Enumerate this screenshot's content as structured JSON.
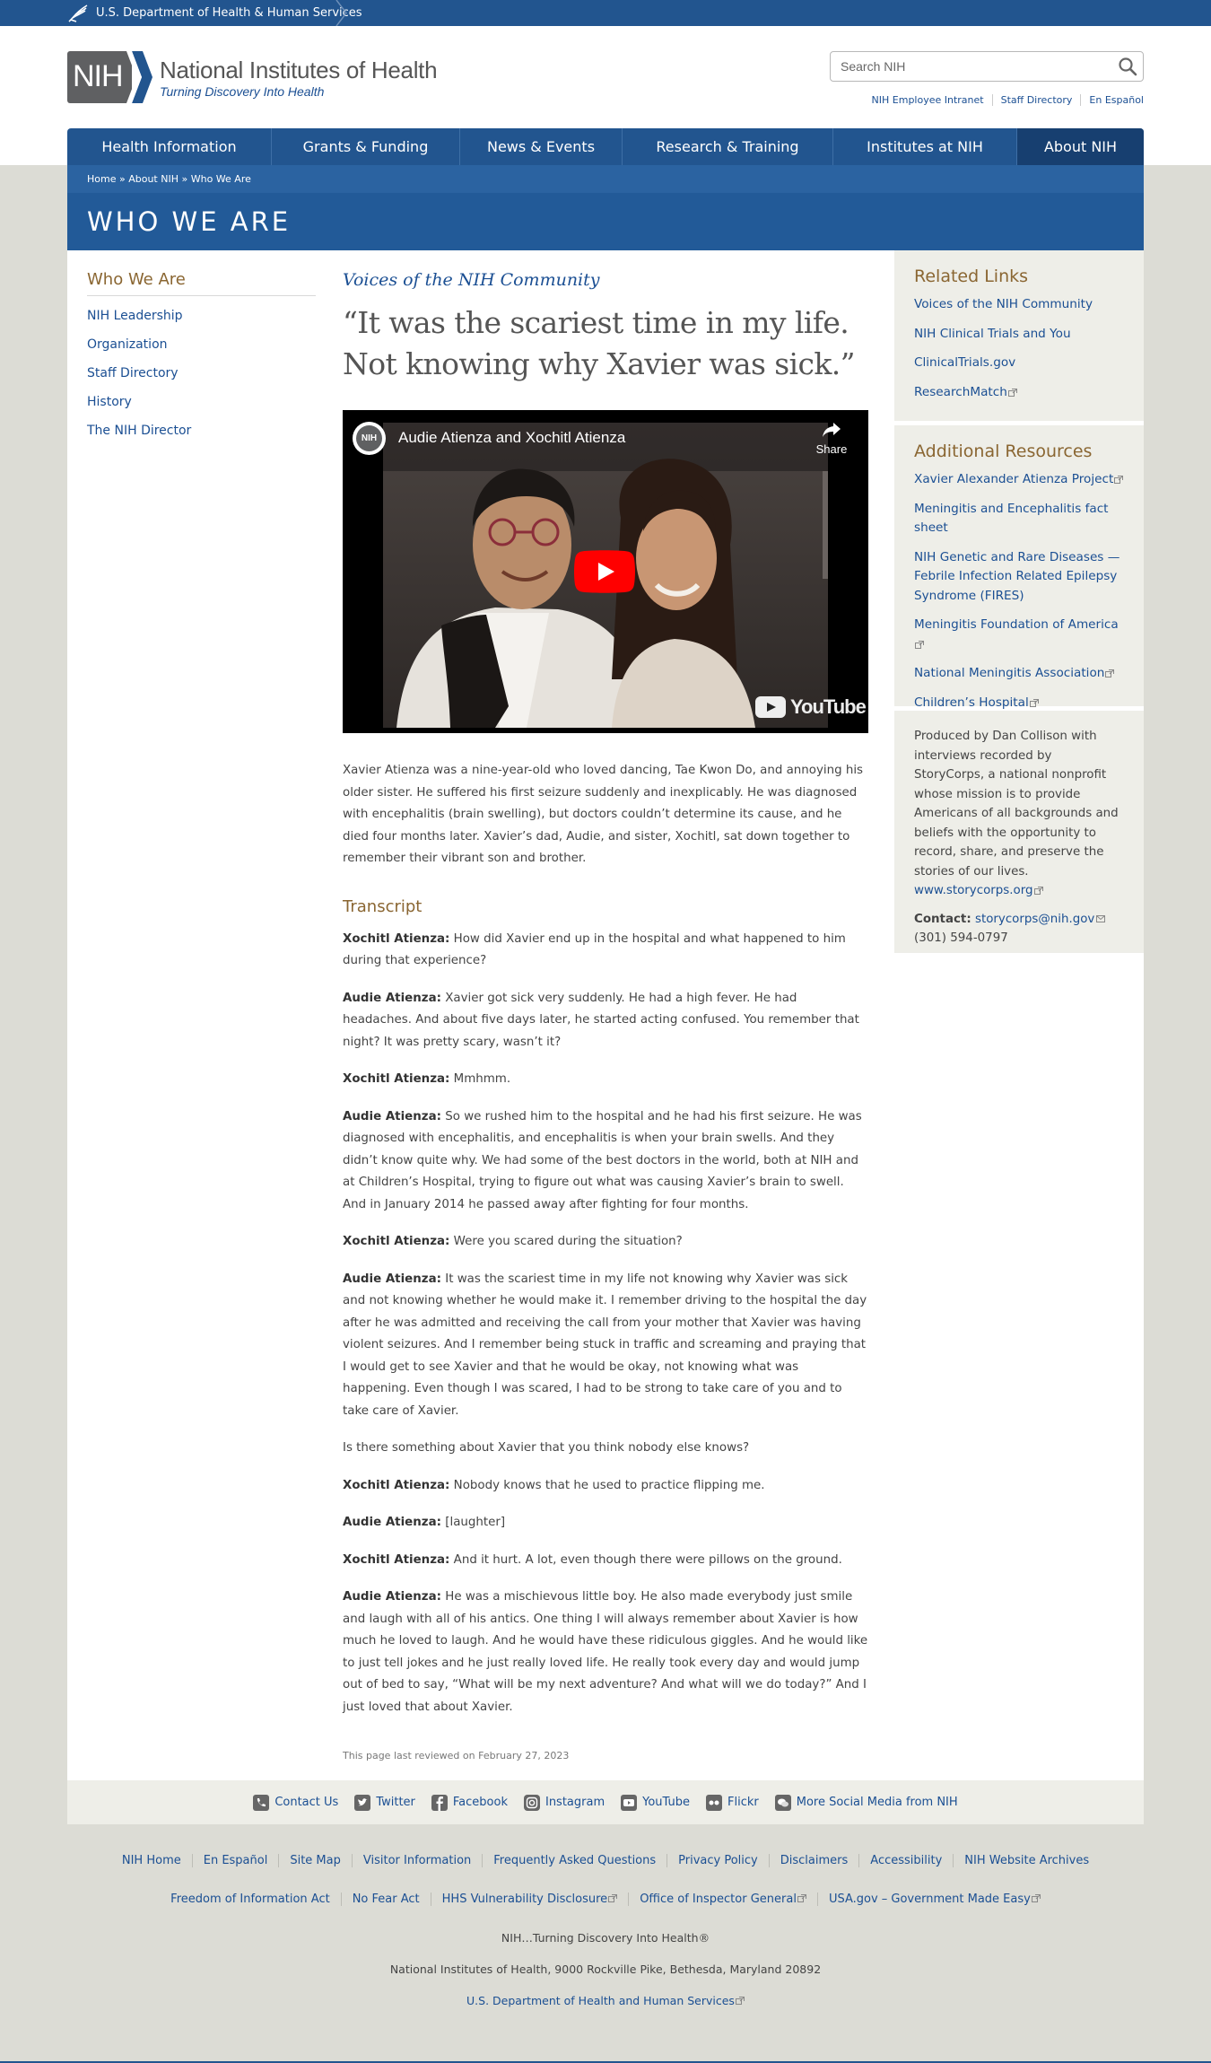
{
  "hhs": {
    "label": "U.S. Department of Health & Human Services"
  },
  "header": {
    "logo_mark": "NIH",
    "title": "National Institutes of Health",
    "tagline": "Turning Discovery Into Health",
    "search_placeholder": "Search NIH",
    "utility_links": [
      "NIH Employee Intranet",
      "Staff Directory",
      "En Español"
    ]
  },
  "nav": {
    "items": [
      "Health Information",
      "Grants & Funding",
      "News & Events",
      "Research & Training",
      "Institutes at NIH",
      "About NIH"
    ]
  },
  "breadcrumb": {
    "home": "Home",
    "sep1": "»",
    "about": "About NIH",
    "sep2": "»",
    "current": "Who We Are"
  },
  "page_title": "WHO WE ARE",
  "sidebar": {
    "heading": "Who We Are",
    "items": [
      "NIH Leadership",
      "Organization",
      "Staff Directory",
      "History",
      "The NIH Director"
    ]
  },
  "article": {
    "kicker": "Voices of the NIH Community",
    "quote": "“It was the scariest time in my life. Not knowing why Xavier was sick.”",
    "video": {
      "channel": "NIH",
      "title": "Audie Atienza and Xochitl Atienza",
      "share": "Share",
      "brand": "YouTube"
    },
    "intro": "Xavier Atienza was a nine-year-old who loved dancing, Tae Kwon Do, and annoying his older sister. He suffered his first seizure suddenly and inexplicably. He was diagnosed with encephalitis (brain swelling), but doctors couldn’t determine its cause, and he died four months later. Xavier’s dad, Audie, and sister, Xochitl, sat down together to remember their vibrant son and brother.",
    "transcript_title": "Transcript",
    "transcript": [
      {
        "speaker": "Xochitl Atienza:",
        "text": "How did Xavier end up in the hospital and what happened to him during that experience?"
      },
      {
        "speaker": "Audie Atienza:",
        "text": "Xavier got sick very suddenly.  He had a high fever.  He had headaches.  And about five days later, he started acting confused.  You remember that night?  It was pretty scary, wasn’t it?"
      },
      {
        "speaker": "Xochitl Atienza:",
        "text": "Mmhmm."
      },
      {
        "speaker": "Audie Atienza:",
        "text": "So we rushed him to the hospital and he had his first seizure.  He was diagnosed with encephalitis, and encephalitis is when your brain swells.  And they didn’t know quite why.  We had some of the best doctors in the world, both at NIH and at Children’s Hospital, trying to figure out what was causing Xavier’s brain to swell.  And in January 2014 he passed away after fighting for four months."
      },
      {
        "speaker": "Xochitl Atienza:",
        "text": "Were you scared during the situation?"
      },
      {
        "speaker": "Audie Atienza:",
        "text": "It was the scariest time in my life not knowing why Xavier was sick and not knowing whether he would make it.  I remember driving to the hospital the day after he was admitted and receiving the call from your mother that Xavier was having violent seizures.  And I remember being stuck in traffic and screaming and praying that I would get to see Xavier and that he would be okay, not knowing what was happening.  Even though I was scared, I had to be strong to take care of you and to take care of Xavier."
      },
      {
        "speaker": "",
        "text": "Is there something about Xavier that you think nobody else knows?"
      },
      {
        "speaker": "Xochitl Atienza:",
        "text": "Nobody knows that he used to practice flipping me."
      },
      {
        "speaker": "Audie Atienza:",
        "text": "[laughter]"
      },
      {
        "speaker": "Xochitl Atienza:",
        "text": "And it hurt.  A lot, even though there were pillows on the ground."
      },
      {
        "speaker": "Audie Atienza:",
        "text": "He was a mischievous little boy.  He also made everybody just smile and laugh with all of his antics.  One thing I will always remember about Xavier is how much he loved to laugh.  And he would have these ridiculous giggles.  And he would like to just tell jokes and he just really loved life.  He really took every day and would jump out of bed to say, “What will be my next adventure?  And what will we do today?”  And I just loved that about Xavier."
      }
    ],
    "reviewed": "This page last reviewed on February 27, 2023"
  },
  "related": {
    "heading": "Related Links",
    "items": [
      "Voices of the NIH Community",
      "NIH Clinical Trials and You",
      "ClinicalTrials.gov",
      "ResearchMatch"
    ]
  },
  "resources": {
    "heading": "Additional Resources",
    "items": [
      "Xavier Alexander Atienza Project",
      "Meningitis and Encephalitis fact sheet",
      "NIH Genetic and Rare Diseases — Febrile Infection Related Epilepsy Syndrome (FIRES)",
      "Meningitis Foundation of America",
      "National Meningitis Association",
      "Children’s Hospital"
    ]
  },
  "credits": {
    "text": "Produced by Dan Collison with interviews recorded by StoryCorps, a national nonprofit whose mission is to provide Americans of all backgrounds and beliefs with the opportunity to record, share, and preserve the stories of our lives.",
    "link": "www.storycorps.org",
    "contact_label": "Contact:",
    "contact_email": "storycorps@nih.gov",
    "phone": "(301) 594-0797"
  },
  "social": {
    "items": [
      "Contact Us",
      "Twitter",
      "Facebook",
      "Instagram",
      "YouTube",
      "Flickr",
      "More Social Media from NIH"
    ]
  },
  "footer": {
    "row1": [
      "NIH Home",
      "En Español",
      "Site Map",
      "Visitor Information",
      "Frequently Asked Questions",
      "Privacy Policy",
      "Disclaimers",
      "Accessibility",
      "NIH Website Archives"
    ],
    "row2": [
      "Freedom of Information Act",
      "No Fear Act",
      "HHS Vulnerability Disclosure",
      "Office of Inspector General",
      "USA.gov – Government Made Easy"
    ],
    "tagline": "NIH…Turning Discovery Into Health®",
    "address": "National Institutes of Health, 9000 Rockville Pike, Bethesda, Maryland 20892",
    "hhs_link": "U.S. Department of Health and Human Services"
  },
  "colors": {
    "nih_blue": "#22558f",
    "heading_gold": "#8a6632",
    "link": "#1b4f93"
  }
}
